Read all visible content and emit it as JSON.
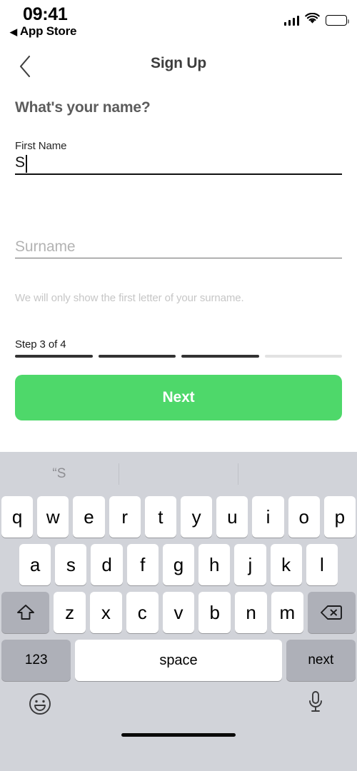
{
  "status_bar": {
    "time": "09:41",
    "back_app_label": "App Store",
    "back_triangle": "◀",
    "signal_icon": "signal-bars-icon",
    "wifi_icon": "wifi-icon",
    "battery_icon": "battery-full-icon"
  },
  "nav": {
    "title": "Sign Up",
    "back_icon": "chevron-left-icon"
  },
  "form": {
    "heading": "What's your name?",
    "first_name": {
      "label": "First Name",
      "value": "S",
      "placeholder": ""
    },
    "surname": {
      "label": "",
      "value": "",
      "placeholder": "Surname"
    },
    "helper_text": "We will only show the first letter of your surname."
  },
  "progress": {
    "label": "Step 3 of 4",
    "current_step": 3,
    "total_steps": 4,
    "segments": [
      true,
      true,
      true,
      false
    ],
    "done_color": "#333333",
    "todo_color": "#e2e2e2"
  },
  "cta": {
    "label": "Next",
    "color": "#4ed86a",
    "text_color": "#ffffff"
  },
  "keyboard": {
    "suggestions": [
      "“S",
      "",
      ""
    ],
    "row1": [
      "q",
      "w",
      "e",
      "r",
      "t",
      "y",
      "u",
      "i",
      "o",
      "p"
    ],
    "row2": [
      "a",
      "s",
      "d",
      "f",
      "g",
      "h",
      "j",
      "k",
      "l"
    ],
    "row3": [
      "z",
      "x",
      "c",
      "v",
      "b",
      "n",
      "m"
    ],
    "shift_icon": "shift-arrow-icon",
    "backspace_icon": "backspace-delete-icon",
    "numeric_key": "123",
    "space_key": "space",
    "return_key": "next",
    "emoji_icon": "emoji-smiley-icon",
    "mic_icon": "microphone-icon",
    "background_color": "#d1d3d9"
  }
}
